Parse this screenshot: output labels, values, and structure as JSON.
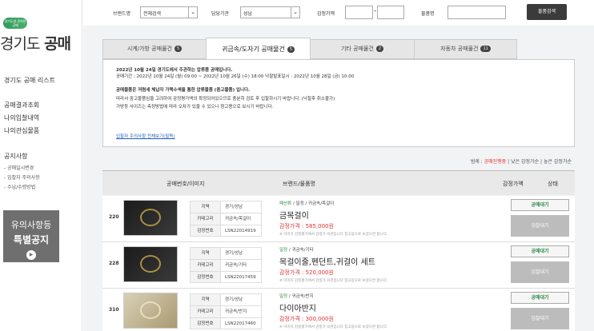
{
  "logo": {
    "badge": "경기도청 온라인 공매",
    "title_a": "경기도",
    "title_b": "공매"
  },
  "sidebar": {
    "items": [
      {
        "label": "경기도 공매 리스트"
      },
      {
        "label": "공매결과조회"
      },
      {
        "label": "나의입찰내역"
      },
      {
        "label": "나의관심물품"
      }
    ],
    "notice_title": "공지사항",
    "notice_subs": [
      "- 공매일시변경",
      "- 입찰자 주의사항",
      "- 수납/수령방법"
    ],
    "banner": {
      "line1": "유의사항등",
      "line2": "특별공지"
    }
  },
  "search": {
    "brand_label": "브랜드명",
    "brand_value": "전체검색",
    "agency_label": "담당기관",
    "agency_value": "성남",
    "price_label": "감정가액",
    "item_label": "물품명",
    "button": "물품검색"
  },
  "tabs": [
    {
      "label": "시계/가방 공매물건",
      "count": "5"
    },
    {
      "label": "귀금속/도자기 공매물건",
      "count": "5"
    },
    {
      "label": "기타 공매물건",
      "count": "2"
    },
    {
      "label": "자동차 공매물건",
      "count": "11"
    }
  ],
  "notice": {
    "line1": "2022년 10월 24일 경기도에서 주관하는 압류품 공매입니다.",
    "line2": "공매기간 : 2022년 10월 24일 (월) 09:00 ~ 2022년 10월 26일 (수) 18:00   낙찰발표일시 : 2022년 10월 28일 (금) 10:00",
    "line3": "공매물품은 저렴세 체납자 가택수색을 통한 압류물품 (중고물품) 입니다.",
    "line4": "따라서 중고물품임을 고려하여 감정평가액의 확정되어있으므로 충분히 검토 후 입찰하시기 바랍니다. (낙찰후 취소불가)",
    "line5": "가방등 사이즈는 측정방법에 따라 오차가 있을 수 있으니 참고용으로 보시기 바랍니다.",
    "link": "입찰자 주의사항 전체보기(필독)"
  },
  "legend": {
    "prefix": "범례 :",
    "a": "공매진행중",
    "b": "낮은 감정가순",
    "c": "높은 감정가순"
  },
  "table": {
    "headers": {
      "id": "공매번호/이미지",
      "brand": "브랜드/물품명",
      "price": "감정가액",
      "status": "상태"
    },
    "rows": [
      {
        "num": "220",
        "region_k": "지역",
        "region_v": "경기/성남",
        "cat_k": "카테고리",
        "cat_v": "귀금속/목걸이",
        "code_k": "감정번호",
        "code_v": "LSN22014919",
        "cat_line_a": "패션류",
        "cat_line_b": "/ 밀정 / 귀금속/목걸이",
        "title": "금목걸이",
        "price": "감정가격 : 585,000원",
        "note": "※ 이미지 감정평가에서 감정가 의견입니다 참고용으로 보셨으면 합니다.",
        "status": "공매대기",
        "bid": "입찰대기"
      },
      {
        "num": "228",
        "region_k": "지역",
        "region_v": "경기/성남",
        "cat_k": "카테고리",
        "cat_v": "귀금속/기타",
        "code_k": "감정번호",
        "code_v": "LSN22017459",
        "cat_line_a": "밀정",
        "cat_line_b": "/ 귀금속/기타",
        "title": "목걸이줄,펜던트,귀걸이 세트",
        "price": "감정가격 : 520,000원",
        "note": "※ 이미지 감정평가에서 감정가 의견입니다 참고용으로 보셨으면 합니다.",
        "status": "공매대기",
        "bid": "입찰대기"
      },
      {
        "num": "310",
        "region_k": "지역",
        "region_v": "경기/성남",
        "cat_k": "카테고리",
        "cat_v": "귀금속/반지",
        "code_k": "감정번호",
        "code_v": "LSN22017460",
        "cat_line_a": "밀정",
        "cat_line_b": "/ 귀금속/반지",
        "title": "다이아반지",
        "price": "감정가격 : 300,000원",
        "note": "※ 이미지 감정평가에서 감정가 의견입니다 참고용으로 보셨으면 합니다.",
        "status": "공매대기",
        "bid": "입찰대기"
      }
    ]
  }
}
